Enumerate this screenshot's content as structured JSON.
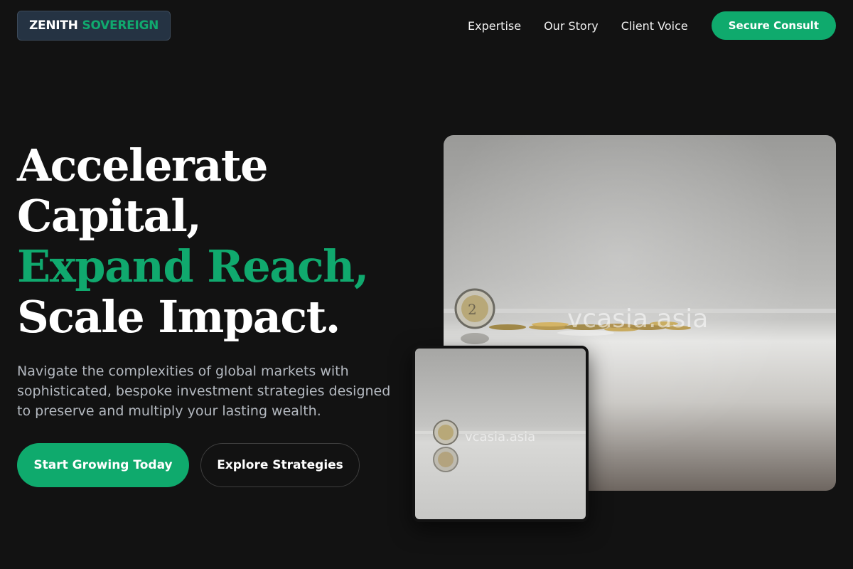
{
  "brand": {
    "part1": "ZENITH",
    "part2": "SOVEREIGN"
  },
  "nav": {
    "items": [
      "Expertise",
      "Our Story",
      "Client Voice"
    ],
    "cta": "Secure Consult"
  },
  "hero": {
    "headline_line1": "Accelerate",
    "headline_line2": "Capital,",
    "headline_line3": "Expand Reach,",
    "headline_line4": "Scale Impact.",
    "lead": "Navigate the complexities of global markets with sophisticated, bespoke investment strategies designed to preserve and multiply your lasting wealth.",
    "primary_button": "Start Growing Today",
    "secondary_button": "Explore Strategies"
  },
  "images": {
    "main_watermark": "vcasia.asia",
    "small_watermark": "vcasia.asia"
  },
  "colors": {
    "background": "#121212",
    "accent": "#10a96e",
    "muted_text": "#b4b9c0"
  }
}
